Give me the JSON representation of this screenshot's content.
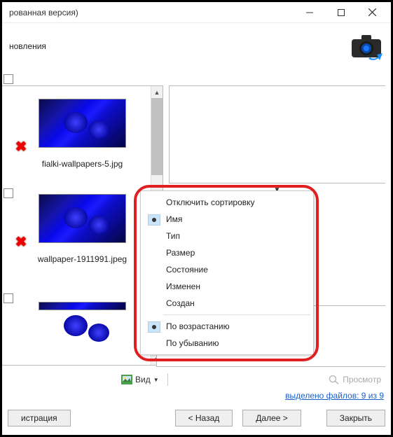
{
  "window": {
    "title_fragment": "рованная версия)"
  },
  "topbar": {
    "text_fragment": "новления"
  },
  "files": [
    {
      "name": "fialki-wallpapers-5.jpg"
    },
    {
      "name": "wallpaper-1911991.jpeg"
    },
    {
      "name": ""
    }
  ],
  "toolbar": {
    "view_label": "Вид",
    "preview_label": "Просмотр"
  },
  "status": {
    "text": "выделено файлов: 9 из 9"
  },
  "buttons": {
    "registration": "истрация",
    "back": "< Назад",
    "next": "Далее >",
    "close": "Закрыть"
  },
  "context_menu": {
    "items": [
      {
        "label": "Отключить сортировку",
        "checked": false
      },
      {
        "label": "Имя",
        "checked": true
      },
      {
        "label": "Тип",
        "checked": false
      },
      {
        "label": "Размер",
        "checked": false
      },
      {
        "label": "Состояние",
        "checked": false
      },
      {
        "label": "Изменен",
        "checked": false
      },
      {
        "label": "Создан",
        "checked": false
      }
    ],
    "order": [
      {
        "label": "По возрастанию",
        "checked": true
      },
      {
        "label": "По убыванию",
        "checked": false
      }
    ]
  }
}
